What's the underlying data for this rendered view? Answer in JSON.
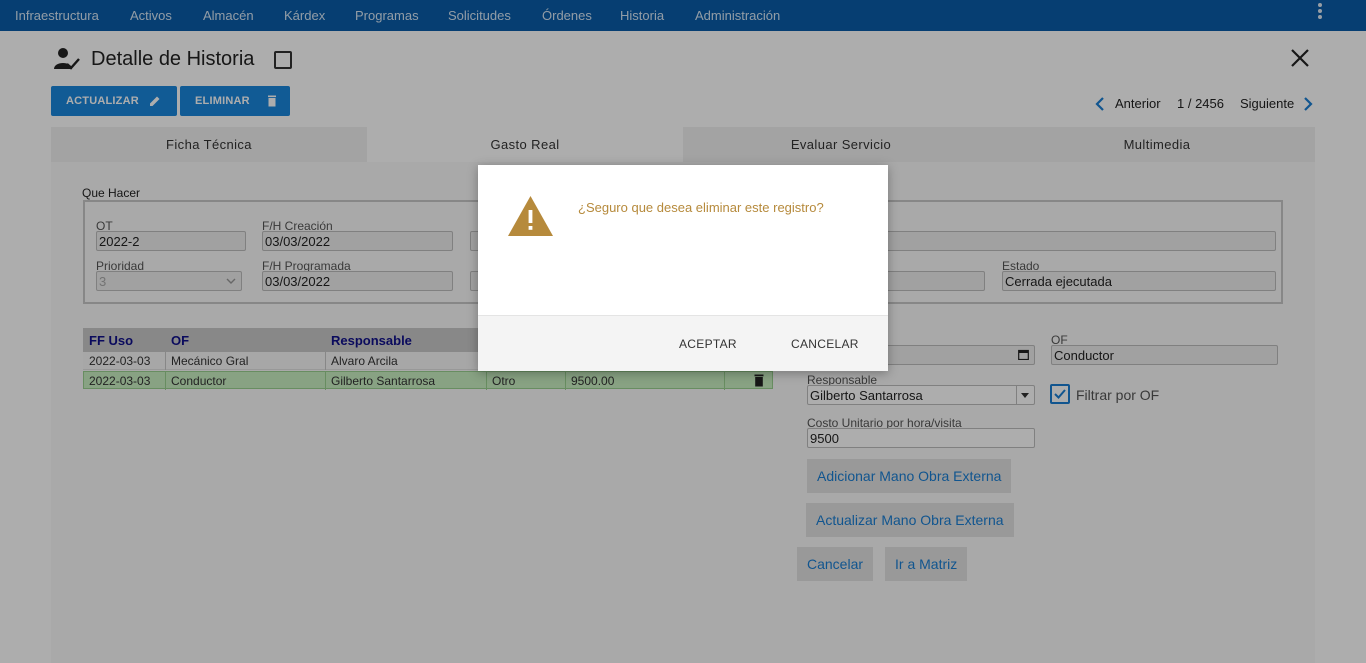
{
  "nav": {
    "items": [
      "Infraestructura",
      "Activos",
      "Almacén",
      "Kárdex",
      "Programas",
      "Solicitudes",
      "Órdenes",
      "Historia",
      "Administración"
    ]
  },
  "header": {
    "title": "Detalle de Historia",
    "actualizar_label": "ACTUALIZAR",
    "eliminar_label": "ELIMINAR",
    "prev_label": "Anterior",
    "page_count": "1 / 2456",
    "next_label": "Siguiente"
  },
  "tabs": [
    {
      "label": "Ficha Técnica"
    },
    {
      "label": "Gasto Real"
    },
    {
      "label": "Evaluar Servicio"
    },
    {
      "label": "Multimedia"
    }
  ],
  "que_hacer": {
    "section_label": "Que Hacer",
    "ot_label": "OT",
    "ot_value": "2022-2",
    "creacion_label": "F/H Creación",
    "creacion_value": "03/03/2022",
    "prioridad_label": "Prioridad",
    "prioridad_value": "3",
    "programada_label": "F/H Programada",
    "programada_value": "03/03/2022",
    "estado_label": "Estado",
    "estado_value": "Cerrada ejecutada"
  },
  "table": {
    "headers": [
      "FF Uso",
      "OF",
      "Responsable"
    ],
    "rows": [
      {
        "ff_uso": "2022-03-03",
        "of": "Mecánico Gral",
        "responsable": "Alvaro Arcila",
        "tipo": "",
        "valor": ""
      },
      {
        "ff_uso": "2022-03-03",
        "of": "Conductor",
        "responsable": "Gilberto Santarrosa",
        "tipo": "Otro",
        "valor": "9500.00"
      }
    ]
  },
  "form": {
    "of_label": "OF",
    "of_value": "Conductor",
    "responsable_label": "Responsable",
    "responsable_value": "Gilberto Santarrosa",
    "filtrar_label": "Filtrar por OF",
    "filtrar_checked": true,
    "costo_label": "Costo Unitario por hora/visita",
    "costo_value": "9500",
    "adicionar_label": "Adicionar Mano Obra Externa",
    "actualizar_label": "Actualizar Mano Obra Externa",
    "cancelar_label": "Cancelar",
    "matriz_label": "Ir a Matriz"
  },
  "dialog": {
    "message": "¿Seguro que desea eliminar este registro?",
    "accept_label": "ACEPTAR",
    "cancel_label": "CANCELAR"
  },
  "colors": {
    "nav_bg": "#0a5ca8",
    "primary": "#1a86dc",
    "warning": "#b68a3c",
    "selected_row": "#c9efc2"
  }
}
